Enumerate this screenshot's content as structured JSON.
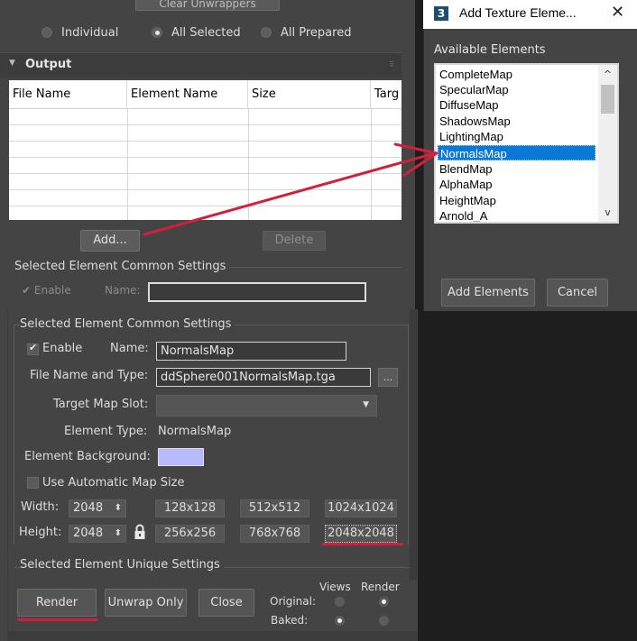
{
  "back_panel": {
    "clear_unwrappers_label": "Clear Unwrappers",
    "radio_options": [
      {
        "label": "Individual",
        "checked": false
      },
      {
        "label": "All Selected",
        "checked": true
      },
      {
        "label": "All Prepared",
        "checked": false
      }
    ],
    "output_rollout_title": "Output",
    "output_table": {
      "columns": [
        "File Name",
        "Element Name",
        "Size",
        "Targ"
      ]
    },
    "add_label": "Add...",
    "delete_label": "Delete",
    "common_settings_title": "Selected Element Common Settings",
    "enable_label": "Enable",
    "name_label": "Name:"
  },
  "common_settings": {
    "group_title": "Selected Element Common Settings",
    "enable_label": "Enable",
    "enable_checked": true,
    "name_label": "Name:",
    "name_value": "NormalsMap",
    "file_type_label": "File Name and Type:",
    "file_type_value": "ddSphere001NormalsMap.tga",
    "browse_label": "...",
    "target_slot_label": "Target Map Slot:",
    "target_slot_value": "",
    "element_type_label": "Element Type:",
    "element_type_value": "NormalsMap",
    "element_bg_label": "Element Background:",
    "element_bg_color": "#b9b9ff",
    "auto_size_label": "Use Automatic Map Size",
    "auto_size_checked": false,
    "width_label": "Width:",
    "width_value": "2048",
    "height_label": "Height:",
    "height_value": "2048",
    "size_presets_row1": [
      "128x128",
      "512x512",
      "1024x1024"
    ],
    "size_presets_row2": [
      "256x256",
      "768x768",
      "2048x2048"
    ],
    "unique_settings_title": "Selected Element Unique Settings"
  },
  "bottom_bar": {
    "render_label": "Render",
    "unwrap_only_label": "Unwrap Only",
    "close_label": "Close",
    "views_header": "Views",
    "render_header": "Render",
    "original_label": "Original:",
    "baked_label": "Baked:",
    "original_views_checked": false,
    "original_render_checked": true,
    "baked_views_checked": true,
    "baked_render_checked": false
  },
  "dialog": {
    "app_icon_label": "3",
    "title": "Add Texture Eleme...",
    "close_glyph": "✕",
    "available_label": "Available Elements",
    "elements": [
      "CompleteMap",
      "SpecularMap",
      "DiffuseMap",
      "ShadowsMap",
      "LightingMap",
      "NormalsMap",
      "BlendMap",
      "AlphaMap",
      "HeightMap",
      "Arnold_A"
    ],
    "selected_index": 5,
    "add_elements_label": "Add Elements",
    "cancel_label": "Cancel"
  },
  "annotation_colors": {
    "red": "#d2203c",
    "selection_blue": "#0a78d7"
  }
}
